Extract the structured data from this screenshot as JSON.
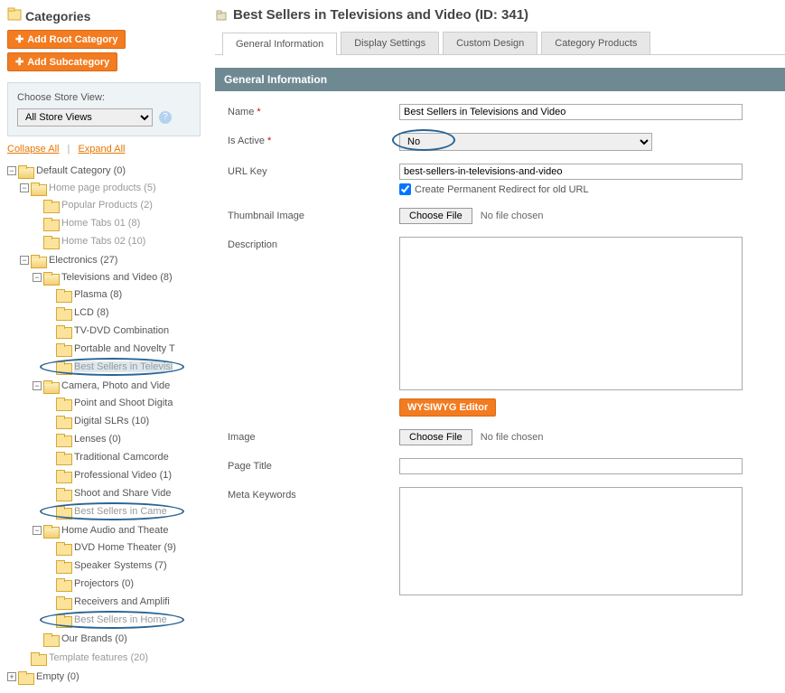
{
  "sidebar": {
    "title": "Categories",
    "add_root_label": "Add Root Category",
    "add_sub_label": "Add Subcategory",
    "store_chooser": {
      "label": "Choose Store View:",
      "value": "All Store Views"
    },
    "tree_controls": {
      "collapse": "Collapse All",
      "expand": "Expand All"
    },
    "tree": {
      "default_category": "Default Category (0)",
      "home_page_products": "Home page products (5)",
      "popular_products": "Popular Products (2)",
      "home_tabs_01": "Home Tabs 01 (8)",
      "home_tabs_02": "Home Tabs 02 (10)",
      "electronics": "Electronics (27)",
      "televisions_video": "Televisions and Video (8)",
      "plasma": "Plasma (8)",
      "lcd": "LCD (8)",
      "tv_dvd": "TV-DVD Combination",
      "portable": "Portable and Novelty T",
      "best_sellers_tv": "Best Sellers in Televisi",
      "camera_photo": "Camera, Photo and Vide",
      "point_shoot": "Point and Shoot Digita",
      "digital_slrs": "Digital SLRs (10)",
      "lenses": "Lenses (0)",
      "traditional": "Traditional Camcorde",
      "professional": "Professional Video (1)",
      "shoot_share": "Shoot and Share Vide",
      "best_sellers_cam": "Best Sellers in Came",
      "home_audio": "Home Audio and Theate",
      "dvd_home": "DVD Home Theater (9)",
      "speaker": "Speaker Systems (7)",
      "projectors": "Projectors (0)",
      "receivers": "Receivers and Amplifi",
      "best_sellers_home": "Best Sellers in Home",
      "our_brands": "Our Brands (0)",
      "template_features": "Template features (20)",
      "empty": "Empty (0)"
    }
  },
  "main": {
    "title": "Best Sellers in Televisions and Video (ID: 341)",
    "tabs": {
      "general": "General Information",
      "display": "Display Settings",
      "custom": "Custom Design",
      "products": "Category Products"
    },
    "section_title": "General Information",
    "form": {
      "name_label": "Name",
      "name_value": "Best Sellers in Televisions and Video",
      "is_active_label": "Is Active",
      "is_active_value": "No",
      "url_key_label": "URL Key",
      "url_key_value": "best-sellers-in-televisions-and-video",
      "redirect_label": "Create Permanent Redirect for old URL",
      "thumbnail_label": "Thumbnail Image",
      "choose_file": "Choose File",
      "no_file": "No file chosen",
      "description_label": "Description",
      "wysiwyg_label": "WYSIWYG Editor",
      "image_label": "Image",
      "page_title_label": "Page Title",
      "meta_keywords_label": "Meta Keywords"
    }
  }
}
